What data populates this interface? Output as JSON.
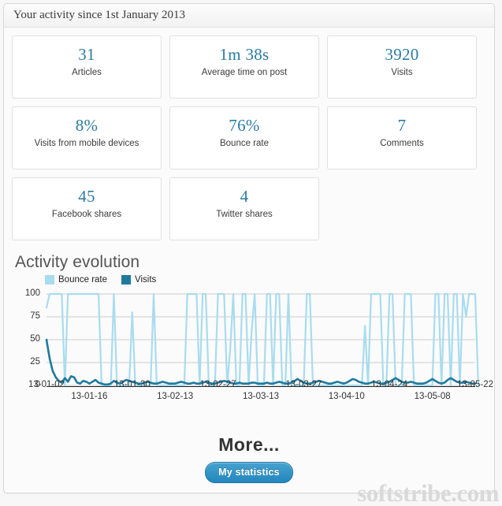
{
  "panel": {
    "title": "Your activity since 1st January 2013"
  },
  "stats": [
    {
      "value": "31",
      "label": "Articles"
    },
    {
      "value": "1m 38s",
      "label": "Average time on post"
    },
    {
      "value": "3920",
      "label": "Visits"
    },
    {
      "value": "8%",
      "label": "Visits from mobile devices"
    },
    {
      "value": "76%",
      "label": "Bounce rate"
    },
    {
      "value": "7",
      "label": "Comments"
    },
    {
      "value": "45",
      "label": "Facebook shares"
    },
    {
      "value": "4",
      "label": "Twitter shares"
    }
  ],
  "section": {
    "title": "Activity evolution"
  },
  "footer": {
    "more_label": "More...",
    "button_label": "My statistics"
  },
  "watermark": {
    "text": "softstribe.com"
  },
  "colors": {
    "accent_blue": "#2b7ba3",
    "bounce_rate": "#a9dcef",
    "visits": "#1f7a9e",
    "button": "#2386bd",
    "panel_bg": "#fbfbfb",
    "page_bg": "#f7f7f7"
  },
  "chart_data": {
    "type": "line",
    "title": "Activity evolution",
    "xlabel": "",
    "ylabel": "",
    "ylim": [
      0,
      100
    ],
    "yticks": [
      0,
      25,
      50,
      75,
      100
    ],
    "grid": true,
    "legend_position": "top-left",
    "x_tick_labels": [
      "13-01-02",
      "13-01-16",
      "13-01-30",
      "13-02-13",
      "13-02-27",
      "13-03-13",
      "13-03-27",
      "13-04-10",
      "13-04-24",
      "13-05-08",
      "13-05-22"
    ],
    "x_tick_indices": [
      0,
      14,
      28,
      42,
      56,
      70,
      84,
      98,
      112,
      126,
      140
    ],
    "x_start": "13-01-02",
    "x_end": "13-05-22",
    "n_points": 141,
    "series": [
      {
        "name": "Bounce rate",
        "color": "#a9dcef",
        "values": [
          85,
          100,
          100,
          100,
          100,
          100,
          0,
          100,
          100,
          100,
          100,
          100,
          100,
          100,
          100,
          100,
          100,
          100,
          0,
          0,
          0,
          0,
          100,
          0,
          0,
          0,
          0,
          0,
          80,
          0,
          0,
          0,
          0,
          0,
          0,
          100,
          0,
          0,
          0,
          0,
          0,
          0,
          0,
          0,
          0,
          0,
          100,
          100,
          100,
          100,
          0,
          100,
          100,
          0,
          0,
          0,
          100,
          100,
          100,
          0,
          40,
          100,
          0,
          0,
          100,
          100,
          0,
          60,
          100,
          0,
          0,
          0,
          100,
          100,
          0,
          100,
          100,
          0,
          0,
          100,
          0,
          0,
          0,
          0,
          0,
          100,
          100,
          0,
          0,
          0,
          0,
          0,
          0,
          0,
          0,
          0,
          0,
          0,
          0,
          0,
          0,
          0,
          0,
          0,
          65,
          0,
          100,
          100,
          100,
          100,
          0,
          0,
          100,
          100,
          0,
          0,
          0,
          100,
          100,
          100,
          0,
          0,
          0,
          0,
          0,
          0,
          0,
          100,
          100,
          0,
          100,
          100,
          0,
          100,
          100,
          0,
          100,
          75,
          100,
          100,
          100,
          0
        ]
      },
      {
        "name": "Visits",
        "color": "#1f7a9e",
        "values": [
          50,
          30,
          16,
          9,
          5,
          3,
          8,
          4,
          10,
          9,
          3,
          2,
          5,
          4,
          2,
          4,
          6,
          3,
          2,
          1,
          1,
          2,
          5,
          3,
          2,
          4,
          6,
          5,
          4,
          3,
          2,
          2,
          3,
          4,
          3,
          2,
          2,
          3,
          4,
          3,
          2,
          2,
          2,
          3,
          4,
          3,
          2,
          2,
          3,
          2,
          2,
          3,
          4,
          3,
          2,
          2,
          3,
          4,
          5,
          4,
          3,
          2,
          2,
          3,
          2,
          2,
          2,
          3,
          3,
          2,
          2,
          2,
          3,
          2,
          2,
          3,
          4,
          3,
          2,
          2,
          3,
          5,
          7,
          5,
          3,
          2,
          2,
          3,
          4,
          5,
          4,
          3,
          2,
          2,
          3,
          4,
          3,
          2,
          3,
          5,
          7,
          6,
          4,
          3,
          2,
          2,
          3,
          4,
          3,
          2,
          2,
          3,
          4,
          6,
          8,
          6,
          4,
          3,
          3,
          4,
          3,
          2,
          2,
          2,
          3,
          5,
          7,
          5,
          3,
          2,
          3,
          6,
          8,
          6,
          4,
          3,
          3,
          4,
          3,
          2,
          2
        ]
      }
    ]
  }
}
